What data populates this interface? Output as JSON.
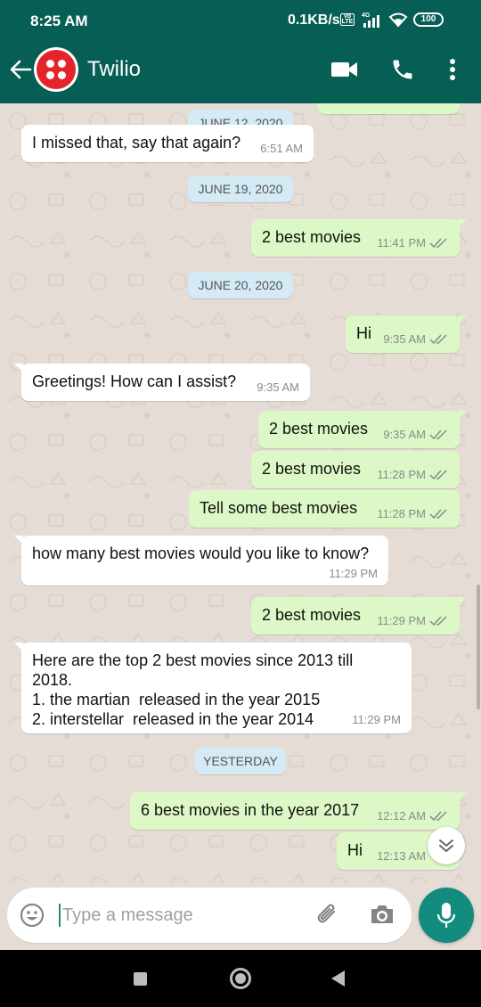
{
  "status_bar": {
    "time": "8:25 AM",
    "net_speed": "0.1KB/s",
    "network_type": "4G",
    "volte_label": "Vo LTE",
    "battery": "100"
  },
  "header": {
    "back_icon": "arrow-left-icon",
    "avatar_icon": "twilio-logo",
    "title": "Twilio",
    "video_icon": "video-call-icon",
    "call_icon": "phone-icon",
    "more_icon": "more-vertical-icon"
  },
  "colors": {
    "header": "#075e54",
    "outgoing_bubble": "#dcf8c6",
    "incoming_bubble": "#ffffff",
    "date_chip": "#d4eaf4",
    "read_ticks": "#8a8a8a",
    "accent": "#128c7e",
    "wallpaper": "#e5ddd5"
  },
  "chat": {
    "dates": [
      "JUNE 12, 2020",
      "JUNE 19, 2020",
      "JUNE 20, 2020",
      "YESTERDAY"
    ],
    "messages": [
      {
        "direction": "in",
        "text": "I missed that, say that again?",
        "time": "6:51 AM"
      },
      {
        "direction": "out",
        "text": "2 best movies",
        "time": "11:41 PM",
        "status": "read"
      },
      {
        "direction": "out",
        "text": "Hi",
        "time": "9:35 AM",
        "status": "read"
      },
      {
        "direction": "in",
        "text": "Greetings! How can I assist?",
        "time": "9:35 AM"
      },
      {
        "direction": "out",
        "text": "2 best movies",
        "time": "9:35 AM",
        "status": "read"
      },
      {
        "direction": "out",
        "text": "2 best movies",
        "time": "11:28 PM",
        "status": "read"
      },
      {
        "direction": "out",
        "text": "Tell some best movies",
        "time": "11:28 PM",
        "status": "read"
      },
      {
        "direction": "in",
        "text": "how many best movies would you like to know?",
        "time": "11:29 PM"
      },
      {
        "direction": "out",
        "text": "2 best movies",
        "time": "11:29 PM",
        "status": "read"
      },
      {
        "direction": "in",
        "text": "Here are the top 2 best movies since 2013 till\n2018.\n1. the martian  released in the year 2015\n2. interstellar  released in the year 2014",
        "time": "11:29 PM"
      },
      {
        "direction": "out",
        "text": "6 best movies in the year 2017",
        "time": "12:12 AM",
        "status": "read"
      },
      {
        "direction": "out",
        "text": "Hi",
        "time": "12:13 AM",
        "status": "read"
      }
    ],
    "scroll_down_icon": "double-chevron-down-icon"
  },
  "composer": {
    "emoji_icon": "emoji-icon",
    "placeholder": "Type a message",
    "attach_icon": "paperclip-icon",
    "camera_icon": "camera-icon",
    "mic_icon": "microphone-icon"
  },
  "nav": {
    "recents_icon": "square-icon",
    "home_icon": "circle-icon",
    "back_icon": "triangle-back-icon"
  }
}
